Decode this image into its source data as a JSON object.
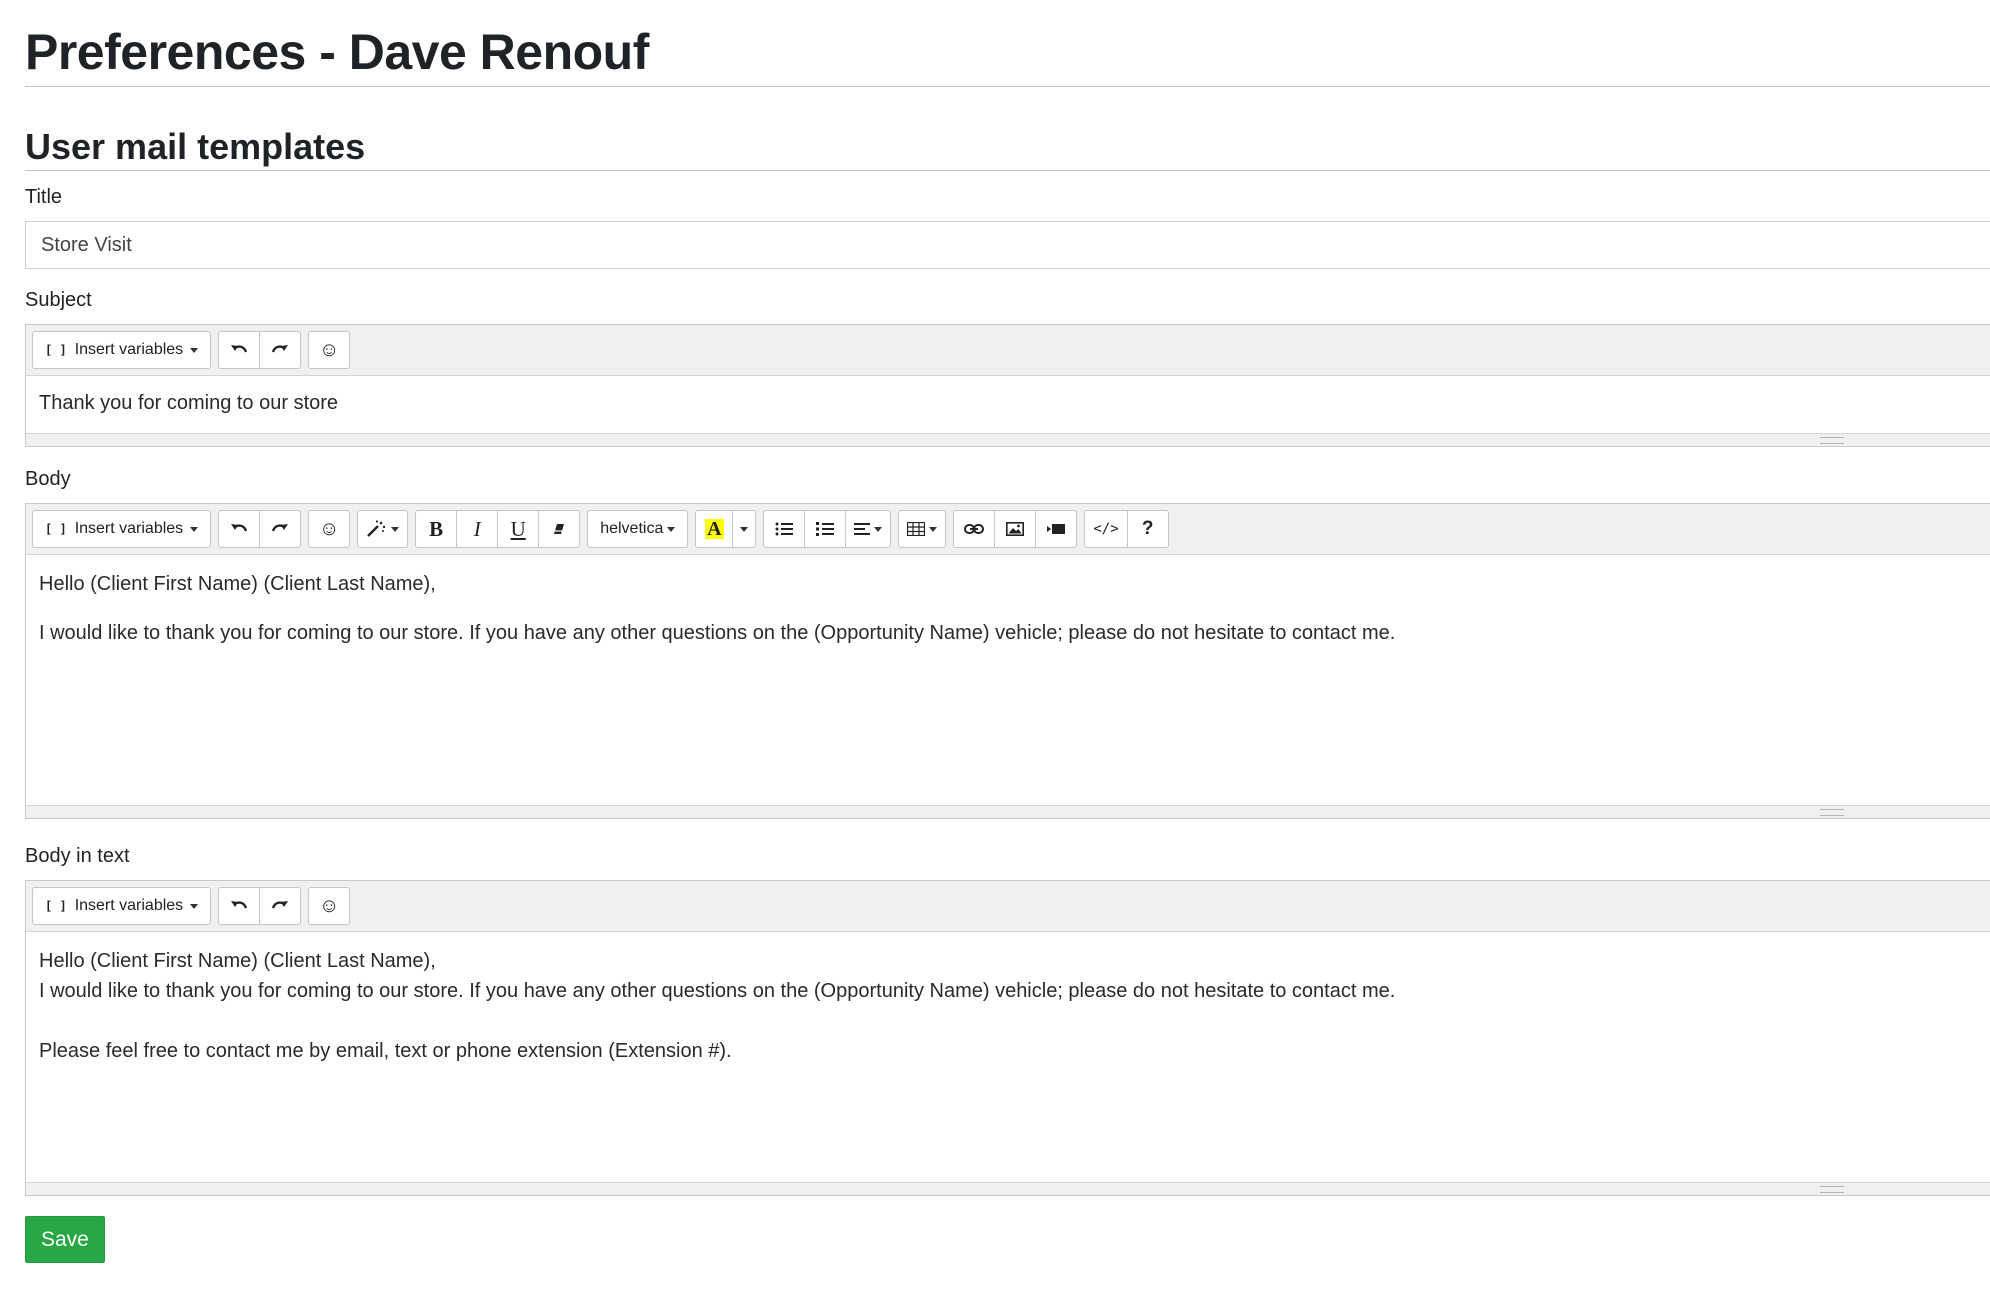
{
  "page": {
    "title": "Preferences - Dave Renouf",
    "section_title": "User mail templates"
  },
  "title_field": {
    "label": "Title",
    "value": "Store Visit"
  },
  "subject_field": {
    "label": "Subject",
    "toolbar": {
      "insert_variables": "Insert variables"
    },
    "value": "Thank you for coming to our store"
  },
  "body_field": {
    "label": "Body",
    "toolbar": {
      "insert_variables": "Insert variables",
      "font_name": "helvetica",
      "bold": "B",
      "italic": "I",
      "underline": "U",
      "code_view": "</>",
      "help": "?",
      "color": "A"
    },
    "lines": [
      "Hello (Client First Name) (Client Last Name),",
      "I would like to thank you for coming to our store. If you have any other questions on the (Opportunity Name) vehicle; please do not hesitate to contact me."
    ]
  },
  "body_text_field": {
    "label": "Body in text",
    "toolbar": {
      "insert_variables": "Insert variables"
    },
    "lines": [
      "Hello (Client First Name) (Client Last Name),",
      "I would like to thank you for coming to our store. If you have any other questions on the (Opportunity Name) vehicle; please do not hesitate to contact me.",
      "Please feel free to contact me by email, text or phone extension (Extension #)."
    ]
  },
  "actions": {
    "save_label": "Save"
  },
  "colors": {
    "save_green": "#28a745",
    "highlight_yellow": "#ffff00",
    "toolbar_bg": "#f0f0f0"
  },
  "icons": {
    "undo": "undo-icon",
    "redo": "redo-icon",
    "emoji": "smiley-icon",
    "style": "magic-wand-icon",
    "eraser": "eraser-icon",
    "unordered_list": "bullet-list-icon",
    "ordered_list": "numbered-list-icon",
    "align": "align-icon",
    "table": "table-icon",
    "link": "link-icon",
    "picture": "image-icon",
    "video": "video-icon"
  }
}
